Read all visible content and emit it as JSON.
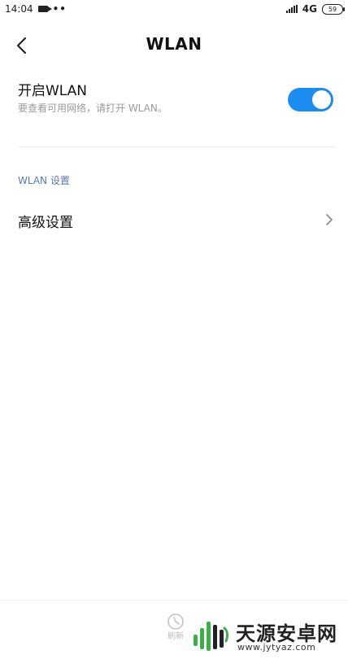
{
  "status_bar": {
    "time": "14:04",
    "dots": "••",
    "network": "4G",
    "battery": "59"
  },
  "header": {
    "title": "WLAN"
  },
  "wlan_toggle": {
    "title": "开启WLAN",
    "subtitle": "要查看可用网络，请打开 WLAN。",
    "enabled": true,
    "accent_color": "#1c8cf0"
  },
  "section": {
    "header": "WLAN 设置"
  },
  "advanced": {
    "label": "高级设置"
  },
  "bottom": {
    "refresh_label": "刷新"
  },
  "watermark": {
    "title": "天源安卓网",
    "url": "www.jytyaz.com"
  },
  "icons": {
    "back": "chevron-left-icon",
    "advanced_arrow": "chevron-right-icon",
    "refresh": "refresh-icon"
  }
}
